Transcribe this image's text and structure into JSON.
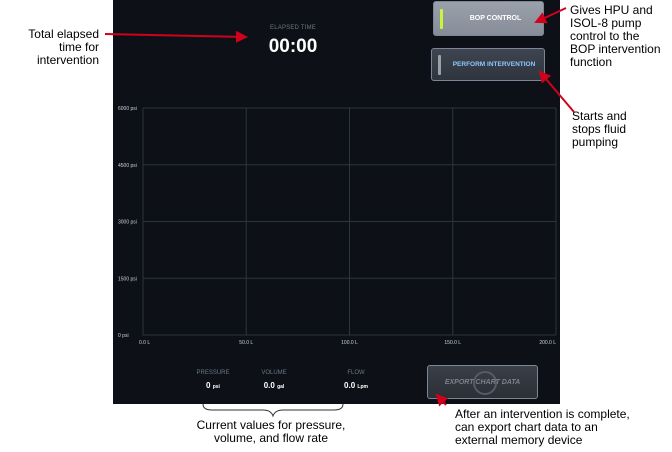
{
  "elapsed": {
    "label": "ELAPSED TIME",
    "time": "00:00"
  },
  "buttons": {
    "bop_control": "BOP CONTROL",
    "perform_intervention": "PERFORM INTERVENTION",
    "export_chart": "EXPORT CHART DATA"
  },
  "readouts": [
    {
      "label": "PRESSURE",
      "value": "0",
      "unit": "psi"
    },
    {
      "label": "VOLUME",
      "value": "0.0",
      "unit": "gal"
    },
    {
      "label": "FLOW",
      "value": "0.0",
      "unit": "Lpm"
    }
  ],
  "chart_data": {
    "type": "line",
    "y_tick_labels": [
      "6000 psi",
      "4500 psi",
      "3000 psi",
      "1500 psi",
      "0 psi"
    ],
    "x_tick_labels": [
      "0.0 L",
      "50.0 L",
      "100.0 L",
      "150.0 L",
      "200.0 L"
    ],
    "ylim": [
      0,
      6000
    ],
    "xlim": [
      0,
      200
    ],
    "grid": true,
    "series": []
  },
  "annotations": {
    "elapsed": "Total elapsed\ntime for\nintervention",
    "bop": "Gives HPU and\nISOL-8 pump\ncontrol to the\nBOP intervention\nfunction",
    "perform": "Starts and\nstops fluid\npumping",
    "readouts": "Current values for pressure,\nvolume, and flow rate",
    "export": "After an intervention is complete,\ncan export chart data to an\nexternal memory device"
  },
  "colors": {
    "screen_bg": "#0d1117",
    "grid_line": "#2b3440",
    "accent_led": "#c6f53a",
    "perform_text": "#8ec8ff",
    "arrow": "#d0021b"
  }
}
